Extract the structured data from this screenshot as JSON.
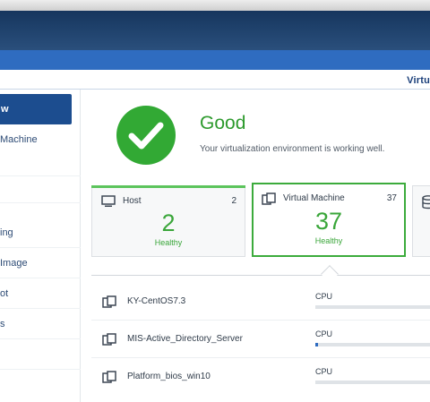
{
  "app": {
    "title": "Virtu"
  },
  "sidebar": {
    "items": [
      {
        "label": "w",
        "active": true
      },
      {
        "label": "Machine"
      },
      {
        "label": "ing"
      },
      {
        "label": "Image"
      },
      {
        "label": "ot"
      },
      {
        "label": "s"
      }
    ]
  },
  "status": {
    "title": "Good",
    "subtitle": "Your virtualization environment is working well."
  },
  "cards": [
    {
      "label": "Host",
      "count": "2",
      "big": "2",
      "state": "Healthy"
    },
    {
      "label": "Virtual Machine",
      "count": "37",
      "big": "37",
      "state": "Healthy"
    }
  ],
  "vm_list": [
    {
      "name": "KY-CentOS7.3",
      "metric": "CPU",
      "usage": 0.0
    },
    {
      "name": "MIS-Active_Directory_Server",
      "metric": "CPU",
      "usage": 0.02
    },
    {
      "name": "Platform_bios_win10",
      "metric": "CPU",
      "usage": 0.0
    }
  ],
  "colors": {
    "healthy": "#3aa63a",
    "accent": "#2f6cc0",
    "nav_active": "#1c4d8f"
  }
}
